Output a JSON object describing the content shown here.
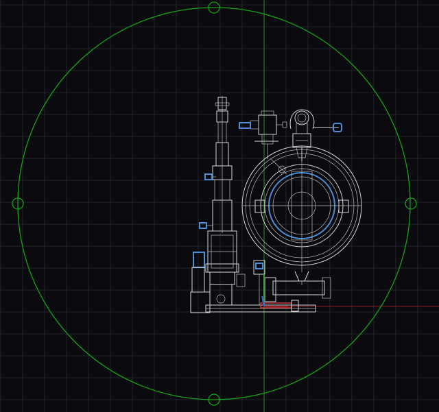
{
  "window": {
    "title": ""
  },
  "canvas": {
    "background": "#0b0b0f",
    "grid_color": "#20242c",
    "grid_visible": true
  },
  "colors": {
    "wireframe": "#d7d7d7",
    "accent_blue": "#4b8fd8",
    "boundary_circle": "#16a316",
    "axis_x": "#8b1f1f",
    "axis_y": "#3aa33a",
    "axis_z": "#2f5fd0"
  },
  "icons": {
    "ucs": "ucs-axis-icon",
    "grip": "grip-icon"
  },
  "model": {
    "name": "valve-assembly-wireframe",
    "visual_style": "2D wireframe"
  }
}
